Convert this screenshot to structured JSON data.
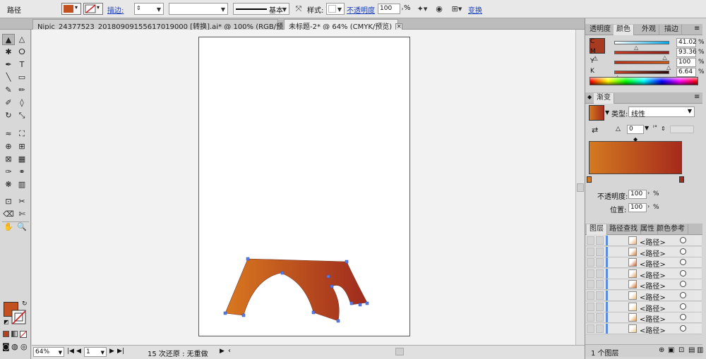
{
  "control_bar": {
    "object_type": "路径",
    "stroke_label": "描边:",
    "stroke_weight": "",
    "profile_value": "",
    "brush_label": "基本",
    "style_label": "样式:",
    "opacity_label": "不透明度",
    "opacity_value": "100",
    "opacity_unit": "%",
    "transform_label": "变换"
  },
  "document_tabs": [
    {
      "title": "Nipic_24377523_20180909155617019000 [转换].ai* @ 100% (RGB/预览)",
      "active": false
    },
    {
      "title": "未标题-2* @ 64% (CMYK/预览)",
      "active": true
    }
  ],
  "status_bar": {
    "zoom": "64%",
    "artboard_number": "1",
    "undo_status": "15 次还原 : 无重做"
  },
  "color_panel": {
    "tabs": [
      "透明度",
      "颜色",
      "外观",
      "描边"
    ],
    "active_tab": "颜色",
    "fill_color": "#a83a22",
    "channels": [
      {
        "label": "C",
        "value": "41.02",
        "fraction": 0.41,
        "colors": [
          "#ffffff",
          "#00a8e8"
        ]
      },
      {
        "label": "M",
        "value": "93.36",
        "fraction": 0.93,
        "colors": [
          "#c83a22",
          "#8e2420"
        ]
      },
      {
        "label": "Y",
        "value": "100",
        "fraction": 1.0,
        "colors": [
          "#b8321a",
          "#c85a1a"
        ]
      },
      {
        "label": "K",
        "value": "6.64",
        "fraction": 0.07,
        "colors": [
          "#c8452a",
          "#2a0a08"
        ]
      }
    ],
    "percent_sign": "%"
  },
  "gradient_panel": {
    "title": "渐变",
    "type_label": "类型:",
    "type_value": "线性",
    "angle_value": "0",
    "gradient_colors": [
      "#d47a20",
      "#a52a1c"
    ],
    "opacity_label": "不透明度:",
    "opacity_value": "100",
    "location_label": "位置:",
    "location_value": "100",
    "percent_sign": "%"
  },
  "layers_panel": {
    "tabs": [
      "图层",
      "路径查找",
      "属性",
      "颜色参考"
    ],
    "active_tab": "图层",
    "rows": [
      {
        "name": "<路径>"
      },
      {
        "name": "<路径>"
      },
      {
        "name": "<路径>"
      },
      {
        "name": "<路径>"
      },
      {
        "name": "<路径>"
      },
      {
        "name": "<路径>"
      },
      {
        "name": "<路径>"
      },
      {
        "name": "<路径>"
      },
      {
        "name": "<路径>"
      }
    ],
    "footer_count": "1 个图层"
  },
  "artwork": {
    "shape_name": "arch",
    "gradient": [
      "#d9781f",
      "#9e2a1e"
    ]
  },
  "tools": [
    "selection-tool",
    "direct-selection-tool",
    "magic-wand-tool",
    "lasso-tool",
    "pen-tool",
    "type-tool",
    "line-tool",
    "rectangle-tool",
    "paintbrush-tool",
    "pencil-tool",
    "blob-brush-tool",
    "eraser-tool",
    "rotate-tool",
    "scale-tool",
    "warp-tool",
    "free-transform-tool",
    "shape-builder-tool",
    "perspective-grid-tool",
    "mesh-tool",
    "gradient-tool",
    "eyedropper-tool",
    "blend-tool",
    "symbol-sprayer-tool",
    "column-graph-tool",
    "artboard-tool",
    "slice-tool",
    "eraser-tool-2",
    "scissors-tool",
    "hand-tool",
    "zoom-tool"
  ]
}
